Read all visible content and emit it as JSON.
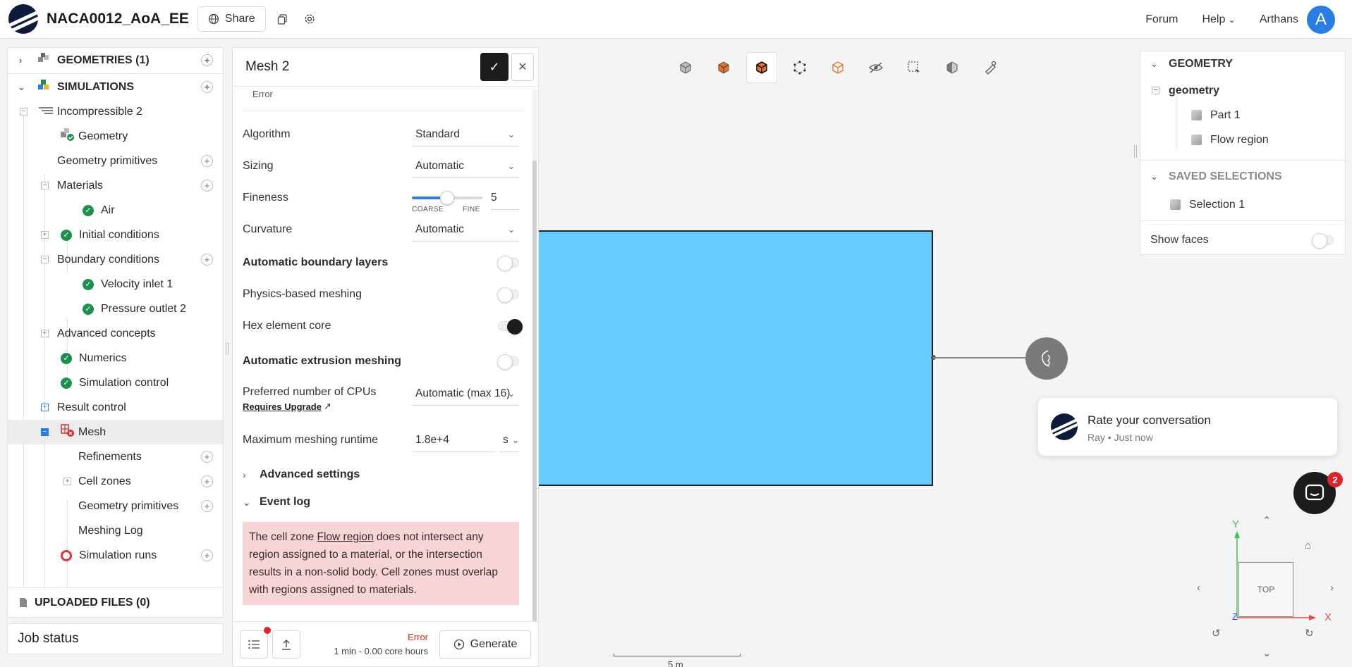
{
  "topbar": {
    "project_title": "NACA0012_AoA_EE",
    "share_label": "Share",
    "forum_label": "Forum",
    "help_label": "Help",
    "user_name": "Arthans",
    "avatar_initial": "A"
  },
  "tree": {
    "geometries_header": "GEOMETRIES (1)",
    "simulations_header": "SIMULATIONS",
    "items": {
      "incompressible": "Incompressible 2",
      "geometry": "Geometry",
      "geometry_primitives": "Geometry primitives",
      "materials": "Materials",
      "air": "Air",
      "initial_conditions": "Initial conditions",
      "boundary_conditions": "Boundary conditions",
      "velocity_inlet": "Velocity inlet 1",
      "pressure_outlet": "Pressure outlet 2",
      "advanced_concepts": "Advanced concepts",
      "numerics": "Numerics",
      "simulation_control": "Simulation control",
      "result_control": "Result control",
      "mesh": "Mesh",
      "refinements": "Refinements",
      "cell_zones": "Cell zones",
      "mesh_geometry_primitives": "Geometry primitives",
      "meshing_log": "Meshing Log",
      "simulation_runs": "Simulation runs"
    },
    "uploaded_files": "UPLOADED FILES (0)",
    "job_status": "Job status"
  },
  "mesh_panel": {
    "title": "Mesh 2",
    "status_label": "Error",
    "algorithm_label": "Algorithm",
    "algorithm_value": "Standard",
    "sizing_label": "Sizing",
    "sizing_value": "Automatic",
    "fineness_label": "Fineness",
    "fineness_value": "5",
    "fineness_level": 0.5,
    "coarse_label": "COARSE",
    "fine_label": "FINE",
    "curvature_label": "Curvature",
    "curvature_value": "Automatic",
    "auto_boundary_layers_label": "Automatic boundary layers",
    "physics_based_label": "Physics-based meshing",
    "hex_core_label": "Hex element core",
    "auto_extrusion_label": "Automatic extrusion meshing",
    "cpus_label": "Preferred number of CPUs",
    "cpus_value": "Automatic (max 16)",
    "requires_upgrade_label": "Requires Upgrade",
    "max_runtime_label": "Maximum meshing runtime",
    "max_runtime_value": "1.8e+4",
    "max_runtime_unit": "s",
    "advanced_settings_label": "Advanced settings",
    "event_log_label": "Event log",
    "error_pre": "The cell zone ",
    "error_link": "Flow region",
    "error_post": " does not intersect any region assigned to a material, or the intersection results in a non-solid body. Cell zones must overlap with regions assigned to materials.",
    "footer_status": "Error",
    "footer_time": "1 min - 0.00 core hours",
    "generate_label": "Generate"
  },
  "right_panel": {
    "geometry_header": "GEOMETRY",
    "geometry_root": "geometry",
    "part1": "Part 1",
    "flow_region": "Flow region",
    "saved_selections_header": "SAVED SELECTIONS",
    "selection1": "Selection 1",
    "show_faces_label": "Show faces"
  },
  "toast": {
    "title": "Rate your conversation",
    "subtitle": "Ray • Just now",
    "badge_count": "2"
  },
  "viewport": {
    "navcube_label": "TOP",
    "axis_y": "Y",
    "axis_x": "X",
    "axis_z": "Z",
    "scale_label": "5 m"
  },
  "colors": {
    "accent": "#2a7de1",
    "flow_region_fill": "#66ccff",
    "error_bg": "#f7d4d6",
    "success": "#1f8f4e",
    "error": "#e0242b"
  }
}
